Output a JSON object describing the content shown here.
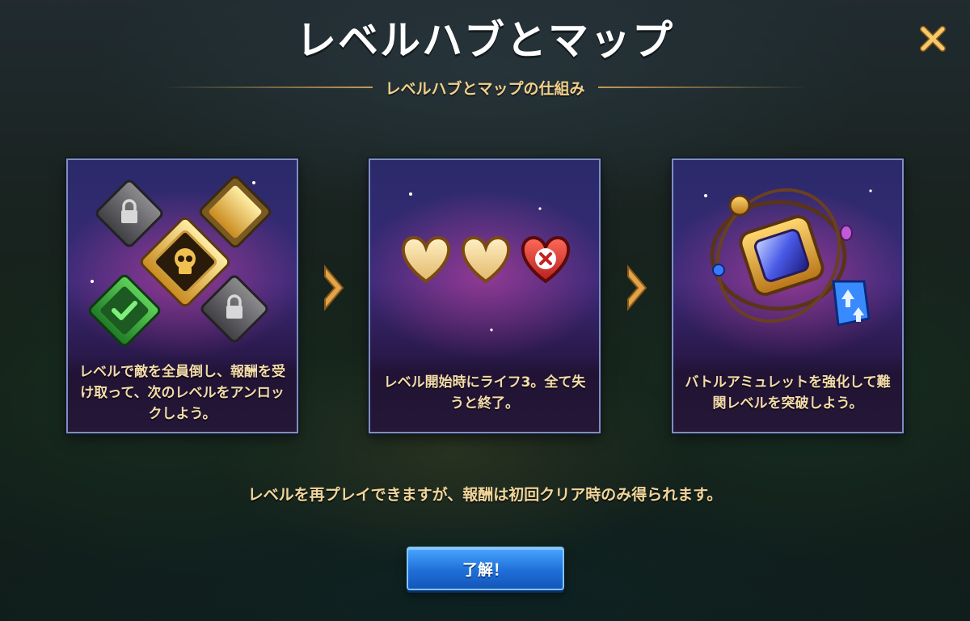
{
  "header": {
    "title": "レベルハブとマップ",
    "subtitle": "レベルハブとマップの仕組み"
  },
  "cards": [
    {
      "icon": "level-medallions-icon",
      "caption": "レベルで敵を全員倒し、報酬を受け取って、次のレベルをアンロックしよう。"
    },
    {
      "icon": "lives-hearts-icon",
      "caption": "レベル開始時にライフ3。全て失うと終了。"
    },
    {
      "icon": "battle-amulet-icon",
      "caption": "バトルアミュレットを強化して難関レベルを突破しよう。"
    }
  ],
  "footer": {
    "note": "レベルを再プレイできますが、報酬は初回クリア時のみ得られます。",
    "ok_label": "了解！"
  },
  "colors": {
    "accent_gold": "#f2cf8a",
    "button_blue": "#1f6fd8",
    "card_border": "#7b8fc0"
  }
}
